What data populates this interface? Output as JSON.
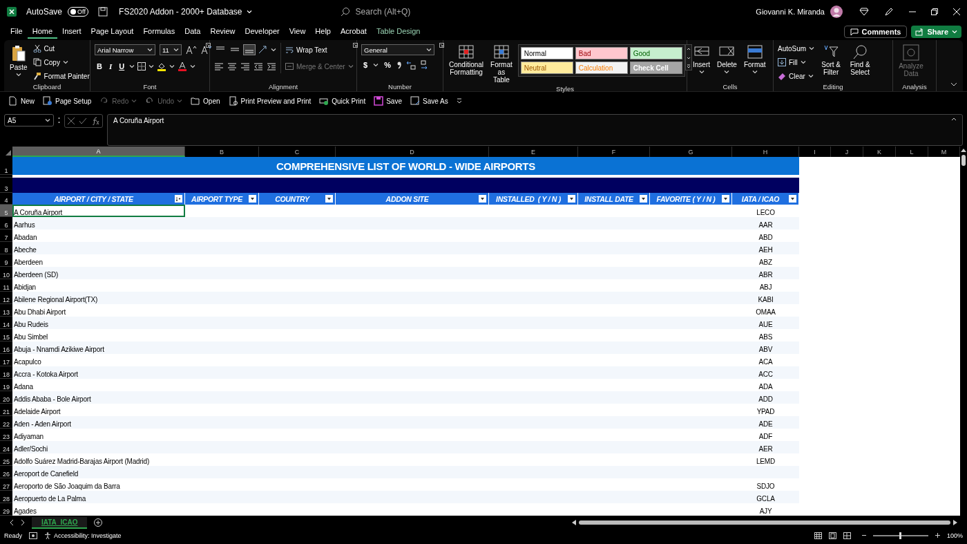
{
  "title_bar": {
    "autosave": {
      "label": "AutoSave",
      "on": false,
      "state_text": "Off"
    },
    "document_title": "FS2020 Addon - 2000+ Database",
    "search_placeholder": "Search (Alt+Q)",
    "user_name": "Giovanni K. Miranda"
  },
  "menu_tabs": [
    {
      "label": "File",
      "selected": false,
      "contextual": false
    },
    {
      "label": "Home",
      "selected": true,
      "contextual": false
    },
    {
      "label": "Insert",
      "selected": false,
      "contextual": false
    },
    {
      "label": "Page Layout",
      "selected": false,
      "contextual": false
    },
    {
      "label": "Formulas",
      "selected": false,
      "contextual": false
    },
    {
      "label": "Data",
      "selected": false,
      "contextual": false
    },
    {
      "label": "Review",
      "selected": false,
      "contextual": false
    },
    {
      "label": "Developer",
      "selected": false,
      "contextual": false
    },
    {
      "label": "View",
      "selected": false,
      "contextual": false
    },
    {
      "label": "Help",
      "selected": false,
      "contextual": false
    },
    {
      "label": "Acrobat",
      "selected": false,
      "contextual": false
    },
    {
      "label": "Table Design",
      "selected": false,
      "contextual": true
    }
  ],
  "header_buttons": {
    "comments": "Comments",
    "share": "Share"
  },
  "ribbon": [
    {
      "kind": "clipboard",
      "label": "Clipboard",
      "controls": [
        {
          "label": "Paste"
        },
        {
          "label": "Cut"
        },
        {
          "label": "Copy"
        },
        {
          "label": "Format Painter"
        }
      ]
    },
    {
      "kind": "font",
      "label": "Font",
      "font_name": "Arial Narrow",
      "font_size": "11",
      "buttons": [
        "B",
        "I",
        "U"
      ]
    },
    {
      "kind": "alignment",
      "label": "Alignment",
      "vertical_align": [
        {
          "selected": false
        },
        {
          "selected": false
        },
        {
          "selected": true
        }
      ],
      "controls": [
        {
          "label": "Wrap Text",
          "disabled": false
        },
        {
          "label": "Merge & Center",
          "disabled": true
        }
      ]
    },
    {
      "kind": "number",
      "label": "Number",
      "format": "General",
      "buttons": [
        "$",
        "%"
      ]
    },
    {
      "kind": "styles",
      "label": "Styles",
      "controls": [
        {
          "label": "Conditional Formatting"
        },
        {
          "label": "Format as Table"
        }
      ],
      "cell_styles": [
        {
          "label": "Normal",
          "color": "#ffffff"
        },
        {
          "label": "Bad",
          "color": "#ffc7ce"
        },
        {
          "label": "Good",
          "color": "#c6efce"
        },
        {
          "label": "Neutral",
          "color": "#ffeb9c"
        },
        {
          "label": "Calculation",
          "color": "#f2f2f2"
        },
        {
          "label": "Check Cell",
          "color": "#a5a5a5"
        }
      ]
    },
    {
      "kind": "cells",
      "label": "Cells",
      "controls": [
        {
          "label": "Insert"
        },
        {
          "label": "Delete"
        },
        {
          "label": "Format"
        }
      ]
    },
    {
      "kind": "editing",
      "label": "Editing",
      "controls": [
        {
          "label": "AutoSum"
        },
        {
          "label": "Fill"
        },
        {
          "label": "Clear"
        },
        {
          "label": "Sort & Filter"
        },
        {
          "label": "Find & Select"
        }
      ]
    },
    {
      "kind": "analysis",
      "label": "Analysis",
      "controls": [
        {
          "label": "Analyze Data",
          "disabled": true
        }
      ]
    }
  ],
  "quick_access": [
    {
      "label": "New",
      "disabled": false
    },
    {
      "label": "Page Setup",
      "disabled": false
    },
    {
      "label": "Redo",
      "disabled": true
    },
    {
      "label": "Undo",
      "disabled": true
    },
    {
      "label": "Open",
      "disabled": false
    },
    {
      "label": "Print Preview and Print",
      "disabled": false
    },
    {
      "label": "Quick Print",
      "disabled": false
    },
    {
      "label": "Save",
      "disabled": false
    },
    {
      "label": "Save As",
      "disabled": false
    }
  ],
  "formula_bar": {
    "name_box": "A5",
    "formula": "A Coruña Airport"
  },
  "sheet": {
    "columns": [
      {
        "label": "A",
        "selected": true
      },
      {
        "label": "B",
        "selected": false
      },
      {
        "label": "C",
        "selected": false
      },
      {
        "label": "D",
        "selected": false
      },
      {
        "label": "E",
        "selected": false
      },
      {
        "label": "F",
        "selected": false
      },
      {
        "label": "G",
        "selected": false
      },
      {
        "label": "H",
        "selected": false
      },
      {
        "label": "I",
        "selected": false
      },
      {
        "label": "J",
        "selected": false
      },
      {
        "label": "K",
        "selected": false
      },
      {
        "label": "L",
        "selected": false
      },
      {
        "label": "M",
        "selected": false
      }
    ],
    "title_row": {
      "number": "1",
      "text": "COMPREHENSIVE LIST OF WORLD - WIDE AIRPORTS"
    },
    "band_row": {
      "number": "3"
    },
    "header_row": {
      "number": "4",
      "headers": [
        "AIRPORT / CITY / STATE",
        "AIRPORT TYPE",
        "COUNTRY",
        "ADDON SITE",
        "INSTALLED  ( Y / N )",
        "INSTALL DATE",
        "FAVORITE ( Y / N )",
        "IATA / ICAO"
      ]
    },
    "rows": [
      {
        "number": "5",
        "airport": "A Coruña Airport",
        "code": "LECO",
        "selected": true
      },
      {
        "number": "6",
        "airport": "Aarhus",
        "code": "AAR",
        "selected": false
      },
      {
        "number": "7",
        "airport": "Abadan",
        "code": "ABD",
        "selected": false
      },
      {
        "number": "8",
        "airport": "Abeche",
        "code": "AEH",
        "selected": false
      },
      {
        "number": "9",
        "airport": "Aberdeen",
        "code": "ABZ",
        "selected": false
      },
      {
        "number": "10",
        "airport": "Aberdeen (SD)",
        "code": "ABR",
        "selected": false
      },
      {
        "number": "11",
        "airport": "Abidjan",
        "code": "ABJ",
        "selected": false
      },
      {
        "number": "12",
        "airport": "Abilene Regional Airport(TX)",
        "code": "KABI",
        "selected": false
      },
      {
        "number": "13",
        "airport": "Abu Dhabi Airport",
        "code": "OMAA",
        "selected": false
      },
      {
        "number": "14",
        "airport": "Abu Rudeis",
        "code": "AUE",
        "selected": false
      },
      {
        "number": "15",
        "airport": "Abu Simbel",
        "code": "ABS",
        "selected": false
      },
      {
        "number": "16",
        "airport": "Abuja - Nnamdi Azikiwe Airport",
        "code": "ABV",
        "selected": false
      },
      {
        "number": "17",
        "airport": "Acapulco",
        "code": "ACA",
        "selected": false
      },
      {
        "number": "18",
        "airport": "Accra - Kotoka Airport",
        "code": "ACC",
        "selected": false
      },
      {
        "number": "19",
        "airport": "Adana",
        "code": "ADA",
        "selected": false
      },
      {
        "number": "20",
        "airport": "Addis Ababa - Bole Airport",
        "code": "ADD",
        "selected": false
      },
      {
        "number": "21",
        "airport": "Adelaide Airport",
        "code": "YPAD",
        "selected": false
      },
      {
        "number": "22",
        "airport": "Aden - Aden Airport",
        "code": "ADE",
        "selected": false
      },
      {
        "number": "23",
        "airport": "Adiyaman",
        "code": "ADF",
        "selected": false
      },
      {
        "number": "24",
        "airport": "Adler/Sochi",
        "code": "AER",
        "selected": false
      },
      {
        "number": "25",
        "airport": "Adolfo Suárez Madrid-Barajas Airport (Madrid)",
        "code": "LEMD",
        "selected": false
      },
      {
        "number": "26",
        "airport": "Aeroport de Canefield",
        "code": "",
        "selected": false
      },
      {
        "number": "27",
        "airport": "Aeroporto de São Joaquim da Barra",
        "code": "SDJO",
        "selected": false
      },
      {
        "number": "28",
        "airport": "Aeropuerto de La Palma",
        "code": "GCLA",
        "selected": false
      },
      {
        "number": "29",
        "airport": "Agades",
        "code": "AJY",
        "selected": false
      }
    ]
  },
  "sheet_tabs": [
    {
      "label": "IATA_ICAO",
      "selected": true
    }
  ],
  "status_bar": {
    "status": "Ready",
    "accessibility": "Accessibility: Investigate",
    "zoom": {
      "level": 0.5,
      "reading": "100%"
    }
  }
}
